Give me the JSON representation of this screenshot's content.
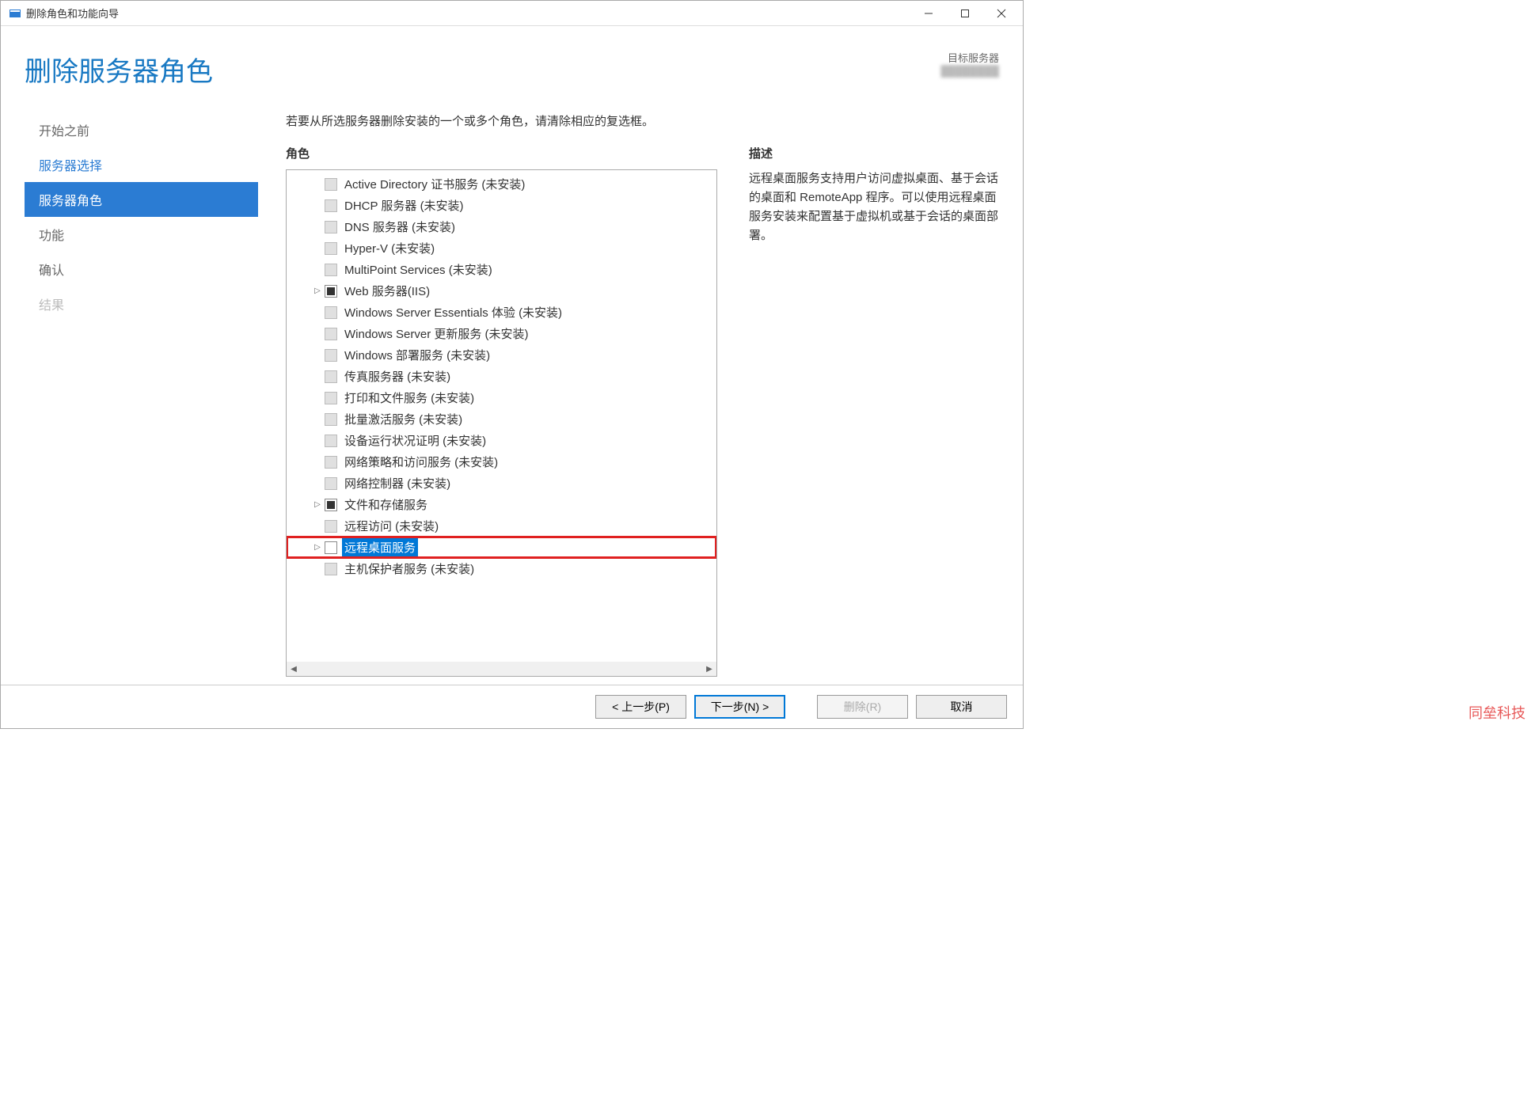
{
  "titlebar": {
    "title": "删除角色和功能向导"
  },
  "header": {
    "page_title": "删除服务器角色",
    "target_label": "目标服务器",
    "target_name": "████████"
  },
  "nav": {
    "items": [
      {
        "label": "开始之前",
        "state": "normal"
      },
      {
        "label": "服务器选择",
        "state": "visited"
      },
      {
        "label": "服务器角色",
        "state": "active"
      },
      {
        "label": "功能",
        "state": "normal"
      },
      {
        "label": "确认",
        "state": "normal"
      },
      {
        "label": "结果",
        "state": "disabled"
      }
    ]
  },
  "main": {
    "instruction": "若要从所选服务器删除安装的一个或多个角色，请清除相应的复选框。",
    "roles_heading": "角色",
    "desc_heading": "描述",
    "description": "远程桌面服务支持用户访问虚拟桌面、基于会话的桌面和 RemoteApp 程序。可以使用远程桌面服务安装来配置基于虚拟机或基于会话的桌面部署。",
    "roles": [
      {
        "label": "Active Directory 证书服务 (未安装)",
        "check": "disabled",
        "expand": ""
      },
      {
        "label": "DHCP 服务器 (未安装)",
        "check": "disabled",
        "expand": ""
      },
      {
        "label": "DNS 服务器 (未安装)",
        "check": "disabled",
        "expand": ""
      },
      {
        "label": "Hyper-V (未安装)",
        "check": "disabled",
        "expand": ""
      },
      {
        "label": "MultiPoint Services (未安装)",
        "check": "disabled",
        "expand": ""
      },
      {
        "label": "Web 服务器(IIS)",
        "check": "mixed",
        "expand": "▷"
      },
      {
        "label": "Windows Server Essentials 体验 (未安装)",
        "check": "disabled",
        "expand": ""
      },
      {
        "label": "Windows Server 更新服务 (未安装)",
        "check": "disabled",
        "expand": ""
      },
      {
        "label": "Windows 部署服务 (未安装)",
        "check": "disabled",
        "expand": ""
      },
      {
        "label": "传真服务器 (未安装)",
        "check": "disabled",
        "expand": ""
      },
      {
        "label": "打印和文件服务 (未安装)",
        "check": "disabled",
        "expand": ""
      },
      {
        "label": "批量激活服务 (未安装)",
        "check": "disabled",
        "expand": ""
      },
      {
        "label": "设备运行状况证明 (未安装)",
        "check": "disabled",
        "expand": ""
      },
      {
        "label": "网络策略和访问服务 (未安装)",
        "check": "disabled",
        "expand": ""
      },
      {
        "label": "网络控制器 (未安装)",
        "check": "disabled",
        "expand": ""
      },
      {
        "label": "文件和存储服务",
        "check": "mixed",
        "expand": "▷"
      },
      {
        "label": "远程访问 (未安装)",
        "check": "disabled",
        "expand": ""
      },
      {
        "label": "远程桌面服务",
        "check": "unchecked",
        "expand": "▷",
        "selected": true,
        "highlighted": true
      },
      {
        "label": "主机保护者服务 (未安装)",
        "check": "disabled",
        "expand": ""
      }
    ]
  },
  "footer": {
    "prev": "< 上一步(P)",
    "next": "下一步(N) >",
    "remove": "删除(R)",
    "cancel": "取消"
  },
  "watermark": "同垒科技"
}
